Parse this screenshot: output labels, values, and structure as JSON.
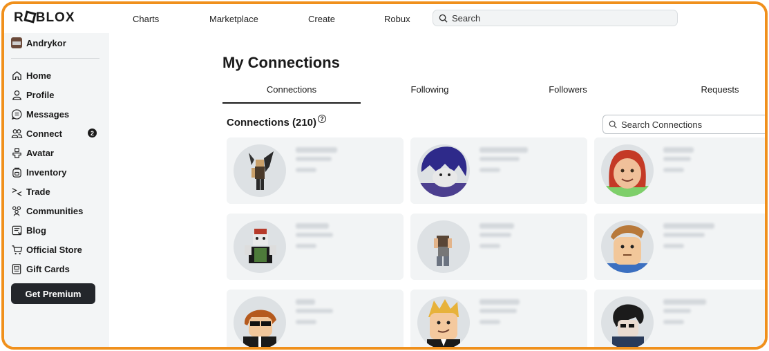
{
  "brand": "ROBLOX",
  "topnav": {
    "links": [
      "Charts",
      "Marketplace",
      "Create",
      "Robux"
    ],
    "search_placeholder": "Search"
  },
  "sidebar": {
    "username": "Andrykor",
    "items": [
      {
        "label": "Home",
        "icon": "home-icon"
      },
      {
        "label": "Profile",
        "icon": "profile-icon"
      },
      {
        "label": "Messages",
        "icon": "messages-icon"
      },
      {
        "label": "Connect",
        "icon": "connect-icon",
        "badge": "2"
      },
      {
        "label": "Avatar",
        "icon": "avatar-icon"
      },
      {
        "label": "Inventory",
        "icon": "inventory-icon"
      },
      {
        "label": "Trade",
        "icon": "trade-icon"
      },
      {
        "label": "Communities",
        "icon": "communities-icon"
      },
      {
        "label": "Blog",
        "icon": "blog-icon"
      },
      {
        "label": "Official Store",
        "icon": "cart-icon"
      },
      {
        "label": "Gift Cards",
        "icon": "gift-card-icon"
      }
    ],
    "premium_button": "Get Premium"
  },
  "main": {
    "title": "My Connections",
    "tabs": [
      "Connections",
      "Following",
      "Followers",
      "Requests"
    ],
    "active_tab": "Connections",
    "section_title": "Connections (210)",
    "help_glyph": "?",
    "search_placeholder": "Search Connections"
  },
  "colors": {
    "frame_border": "#f0901c",
    "sidebar_bg": "#f3f5f6",
    "card_bg": "#f2f4f5",
    "premium_bg": "#23262b"
  }
}
